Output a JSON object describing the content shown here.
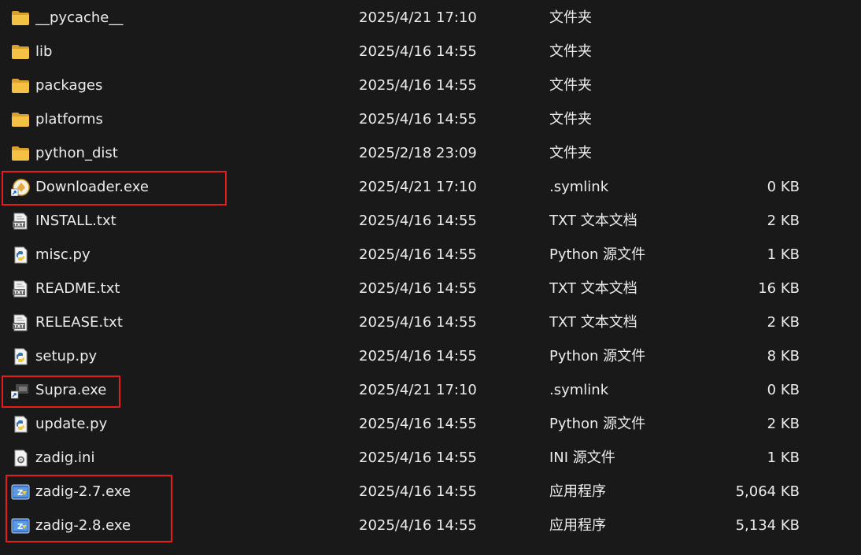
{
  "files": [
    {
      "name": "__pycache__",
      "date": "2025/4/21 17:10",
      "type": "文件夹",
      "size": "",
      "icon": "folder-icon"
    },
    {
      "name": "lib",
      "date": "2025/4/16 14:55",
      "type": "文件夹",
      "size": "",
      "icon": "folder-icon"
    },
    {
      "name": "packages",
      "date": "2025/4/16 14:55",
      "type": "文件夹",
      "size": "",
      "icon": "folder-icon"
    },
    {
      "name": "platforms",
      "date": "2025/4/16 14:55",
      "type": "文件夹",
      "size": "",
      "icon": "folder-icon"
    },
    {
      "name": "python_dist",
      "date": "2025/2/18 23:09",
      "type": "文件夹",
      "size": "",
      "icon": "folder-icon"
    },
    {
      "name": "Downloader.exe",
      "date": "2025/4/21 17:10",
      "type": ".symlink",
      "size": "0 KB",
      "icon": "downloader-shortcut-icon"
    },
    {
      "name": "INSTALL.txt",
      "date": "2025/4/16 14:55",
      "type": "TXT 文本文档",
      "size": "2 KB",
      "icon": "text-file-icon"
    },
    {
      "name": "misc.py",
      "date": "2025/4/16 14:55",
      "type": "Python 源文件",
      "size": "1 KB",
      "icon": "python-file-icon"
    },
    {
      "name": "README.txt",
      "date": "2025/4/16 14:55",
      "type": "TXT 文本文档",
      "size": "16 KB",
      "icon": "text-file-icon"
    },
    {
      "name": "RELEASE.txt",
      "date": "2025/4/16 14:55",
      "type": "TXT 文本文档",
      "size": "2 KB",
      "icon": "text-file-icon"
    },
    {
      "name": "setup.py",
      "date": "2025/4/16 14:55",
      "type": "Python 源文件",
      "size": "8 KB",
      "icon": "python-file-icon"
    },
    {
      "name": "Supra.exe",
      "date": "2025/4/21 17:10",
      "type": ".symlink",
      "size": "0 KB",
      "icon": "shortcut-icon"
    },
    {
      "name": "update.py",
      "date": "2025/4/16 14:55",
      "type": "Python 源文件",
      "size": "2 KB",
      "icon": "python-file-icon"
    },
    {
      "name": "zadig.ini",
      "date": "2025/4/16 14:55",
      "type": "INI 源文件",
      "size": "1 KB",
      "icon": "ini-file-icon"
    },
    {
      "name": "zadig-2.7.exe",
      "date": "2025/4/16 14:55",
      "type": "应用程序",
      "size": "5,064 KB",
      "icon": "zadig-app-icon"
    },
    {
      "name": "zadig-2.8.exe",
      "date": "2025/4/16 14:55",
      "type": "应用程序",
      "size": "5,134 KB",
      "icon": "zadig-app-icon"
    }
  ],
  "colors": {
    "background": "#191919",
    "text": "#ececec",
    "highlight": "#e51c1c",
    "folder": "#f4c145"
  }
}
